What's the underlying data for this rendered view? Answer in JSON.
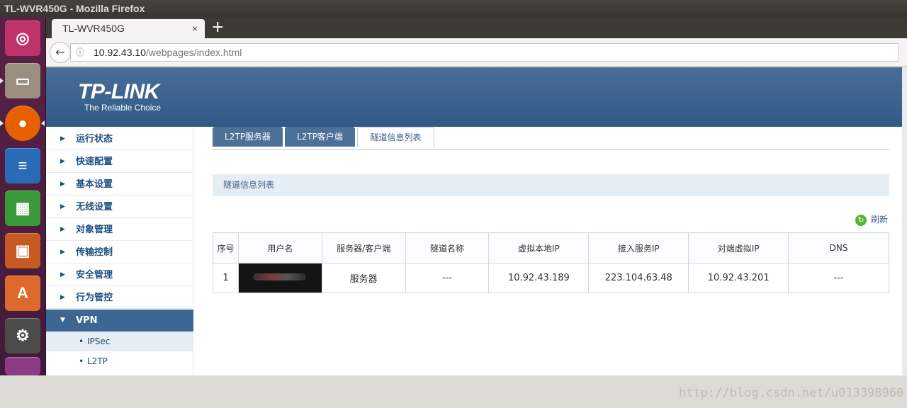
{
  "window": {
    "title": "TL-WVR450G - Mozilla Firefox"
  },
  "launcher": {
    "items": [
      {
        "icon": "ubuntu-dash-icon",
        "color": "#c0336a"
      },
      {
        "icon": "files-icon",
        "color": "#9a8f7e"
      },
      {
        "icon": "firefox-icon",
        "color": "#e66000"
      },
      {
        "icon": "writer-icon",
        "color": "#2a6bb5"
      },
      {
        "icon": "calc-icon",
        "color": "#3a9a3a"
      },
      {
        "icon": "impress-icon",
        "color": "#c55a22"
      },
      {
        "icon": "software-center-icon",
        "color": "#dd6a2c"
      },
      {
        "icon": "system-settings-icon",
        "color": "#4b4b4b"
      },
      {
        "icon": "workspace-icon",
        "color": "#8e3b86"
      }
    ]
  },
  "browser": {
    "tab_title": "TL-WVR450G",
    "tab_close": "×",
    "new_tab": "+",
    "url_host": "10.92.43.10",
    "url_path": "/webpages/index.html"
  },
  "brand": {
    "logo": "TP-LINK",
    "slogan": "The Reliable Choice"
  },
  "sidebar": {
    "items": [
      {
        "label": "运行状态"
      },
      {
        "label": "快速配置"
      },
      {
        "label": "基本设置"
      },
      {
        "label": "无线设置"
      },
      {
        "label": "对象管理"
      },
      {
        "label": "传输控制"
      },
      {
        "label": "安全管理"
      },
      {
        "label": "行为管控"
      },
      {
        "label": "VPN"
      }
    ],
    "sub_items": [
      {
        "label": "IPSec"
      },
      {
        "label": "L2TP"
      }
    ]
  },
  "tabs": [
    {
      "label": "L2TP服务器"
    },
    {
      "label": "L2TP客户端"
    },
    {
      "label": "隧道信息列表"
    }
  ],
  "section_title": "隧道信息列表",
  "refresh_label": "刷新",
  "table": {
    "headers": [
      "序号",
      "用户名",
      "服务器/客户端",
      "隧道名称",
      "虚拟本地IP",
      "接入服务IP",
      "对端虚拟IP",
      "DNS"
    ],
    "rows": [
      [
        "1",
        "",
        "服务器",
        "---",
        "10.92.43.189",
        "223.104.63.48",
        "10.92.43.201",
        "---"
      ]
    ]
  },
  "watermark": "http://blog.csdn.net/u013398960"
}
